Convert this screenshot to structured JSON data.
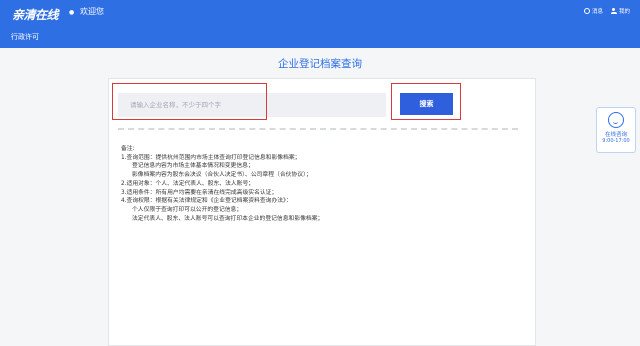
{
  "header": {
    "logo": "亲清在线",
    "welcome": "欢迎您",
    "nav_permit": "行政许可",
    "messages_label": "消息",
    "mine_label": "我的"
  },
  "page_title": "企业登记档案查询",
  "search": {
    "placeholder": "请输入企业名称，不少于四个字",
    "button_label": "搜索"
  },
  "notes": [
    "备注:",
    "1.查询范围：提供杭州范围内市场主体查询打印登记信息和影像档案；",
    "登记信息内容为市场主体基本情况和变更信息；",
    "影像档案内容为股东会决议（合伙人决定书）、公司章程（合伙协议）；",
    "2.适用对象：个人、法定代表人、股东、法人账号；",
    "3.适用条件：所有用户均需要在亲清在线完成高级实名认证；",
    "4.查询权限：根据有关法律规定和《企业登记档案资料查询办法》：",
    "个人仅限于查询打印可以公开的登记信息；",
    "法定代表人、股东、法人账号可以查询打印本企业的登记信息和影像档案；"
  ],
  "help": {
    "label": "在线咨询",
    "hours": "9:00-17:00"
  },
  "colors": {
    "brand_blue": "#2f6fe4",
    "button_blue": "#2f5fdc",
    "annotation_red": "#d93a3a"
  }
}
